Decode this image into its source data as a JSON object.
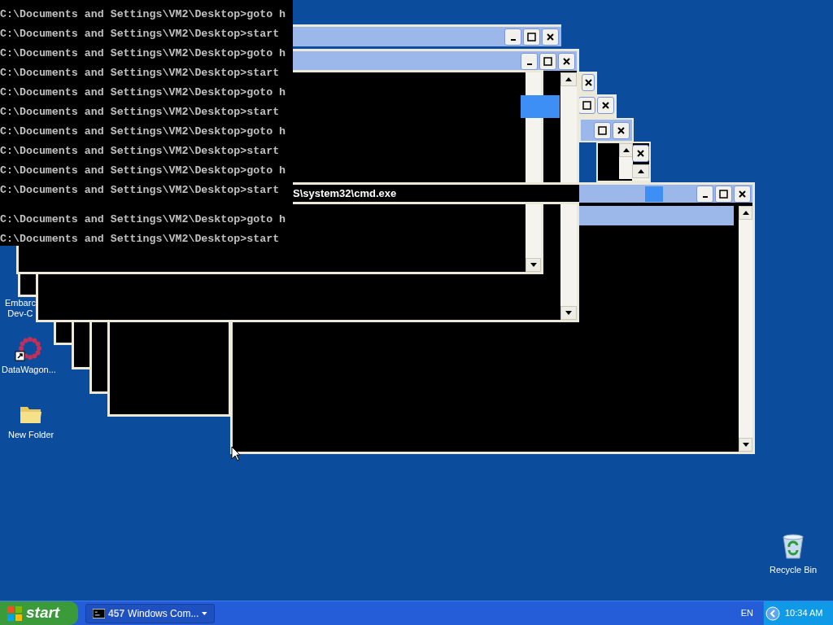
{
  "console": {
    "lines": [
      "C:\\Documents and Settings\\VM2\\Desktop>goto h",
      "C:\\Documents and Settings\\VM2\\Desktop>start",
      "C:\\Documents and Settings\\VM2\\Desktop>goto h",
      "C:\\Documents and Settings\\VM2\\Desktop>start",
      "C:\\Documents and Settings\\VM2\\Desktop>goto h",
      "C:\\Documents and Settings\\VM2\\Desktop>start",
      "C:\\Documents and Settings\\VM2\\Desktop>goto h",
      "C:\\Documents and Settings\\VM2\\Desktop>start",
      "C:\\Documents and Settings\\VM2\\Desktop>goto h",
      "C:\\Documents and Settings\\VM2\\Desktop>start",
      "C:\\Documents and Settings\\VM2\\Desktop>goto h",
      "C:\\Documents and Settings\\VM2\\Desktop>start"
    ]
  },
  "cmd_window": {
    "title": "S\\system32\\cmd.exe"
  },
  "desktop_icons": [
    {
      "kind": "app",
      "label_lines": [
        "Embarc",
        "Dev-C"
      ]
    },
    {
      "kind": "shortcut",
      "label_lines": [
        "DataWagon..."
      ]
    },
    {
      "kind": "folder",
      "label_lines": [
        "New Folder"
      ]
    },
    {
      "kind": "recycle",
      "label_lines": [
        "Recycle Bin"
      ]
    }
  ],
  "taskbar": {
    "start": "start",
    "task_button": {
      "count": "457",
      "label": "Windows Com..."
    },
    "language": "EN",
    "clock": "10:34 AM"
  }
}
